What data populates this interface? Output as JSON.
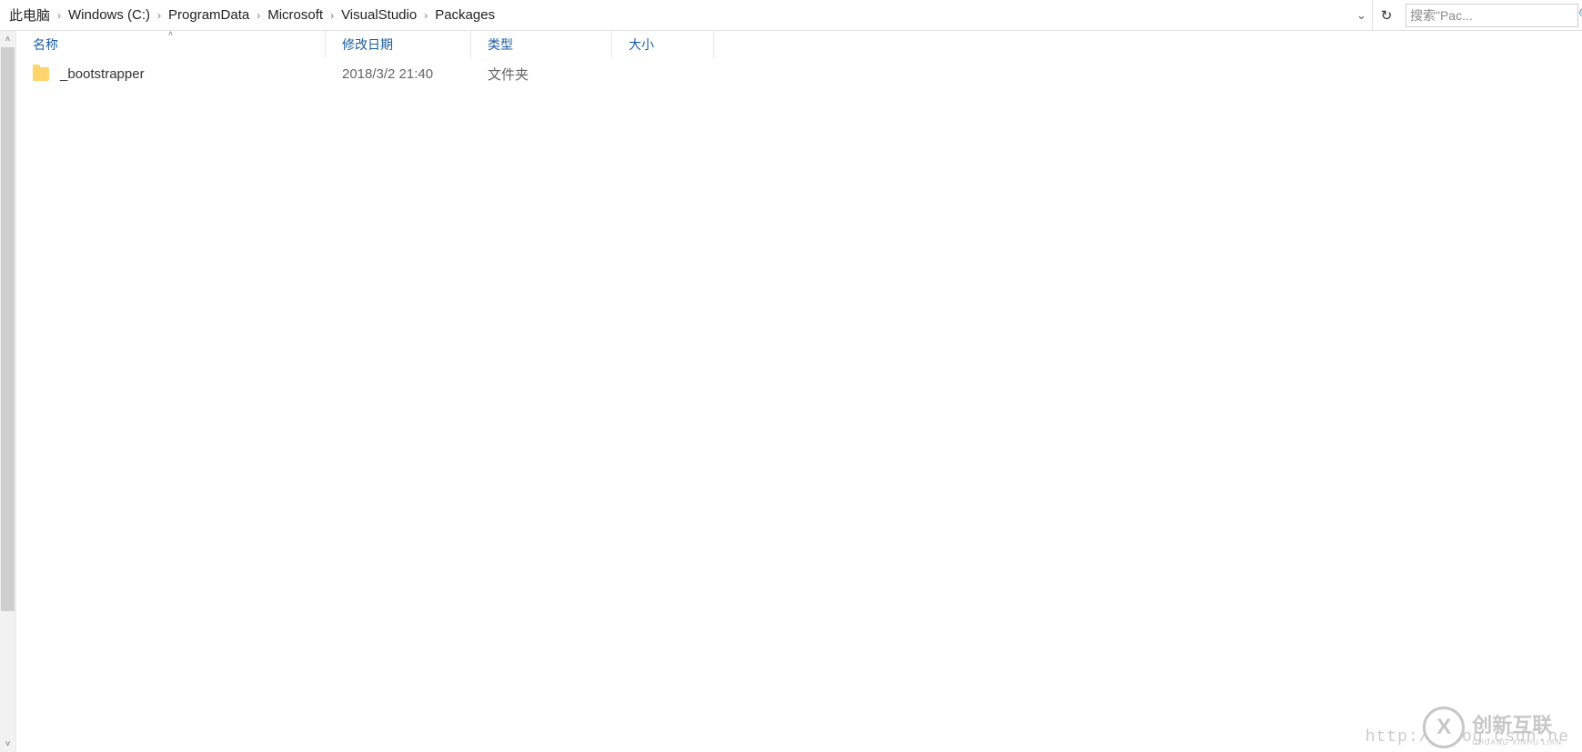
{
  "breadcrumb": {
    "segments": [
      "此电脑",
      "Windows (C:)",
      "ProgramData",
      "Microsoft",
      "VisualStudio",
      "Packages"
    ]
  },
  "search": {
    "placeholder": "搜索\"Pac..."
  },
  "columns": {
    "name": "名称",
    "date": "修改日期",
    "type": "类型",
    "size": "大小"
  },
  "rows": [
    {
      "name": "_bootstrapper",
      "date": "2018/3/2 21:40",
      "type": "文件夹",
      "size": ""
    }
  ],
  "watermark": {
    "url": "http://blog.csdn.ne",
    "brand": "创新互联",
    "brand_sub": "CHUANG XINHU LIAN",
    "symbol": "X"
  }
}
